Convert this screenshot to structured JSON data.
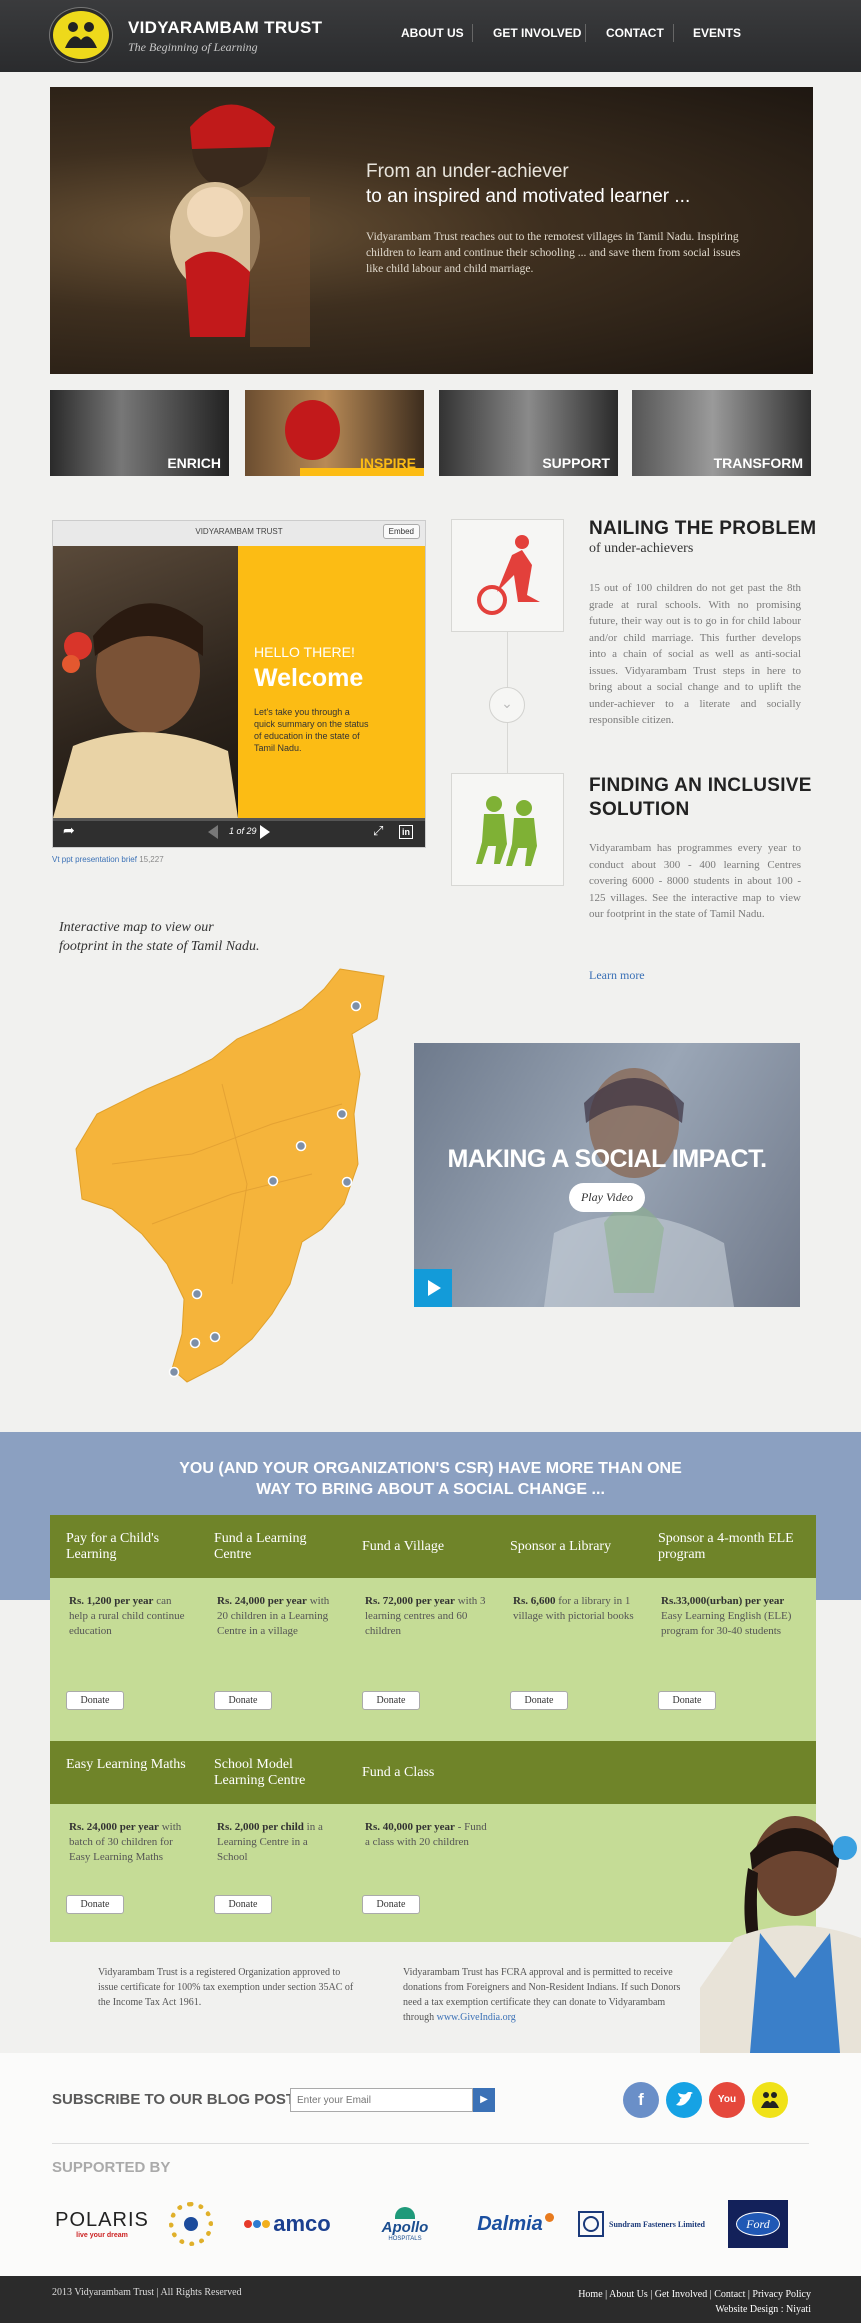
{
  "header": {
    "brand": "VIDYARAMBAM TRUST",
    "tagline": "The Beginning of Learning",
    "nav": [
      "ABOUT US",
      "GET INVOLVED",
      "CONTACT",
      "EVENTS"
    ]
  },
  "hero": {
    "line1": "From an under-achiever",
    "line2": "to an inspired and motivated learner ...",
    "body": "Vidyarambam Trust reaches out to the remotest villages in Tamil Nadu. Inspiring children to learn and continue their schooling ... and save them from social issues like child labour and child marriage."
  },
  "tiles": [
    "ENRICH",
    "INSPIRE",
    "SUPPORT",
    "TRANSFORM"
  ],
  "slideshow": {
    "title": "VIDYARAMBAM TRUST",
    "embed": "Embed",
    "hello": "HELLO THERE!",
    "welcome": "Welcome",
    "summary": "Let's take you through a quick summary on the status of education in the state of Tamil Nadu.",
    "counter": "1 of 29",
    "caption_link": "Vt ppt presentation brief",
    "caption_views": "15,227"
  },
  "problem": {
    "title": "NAILING THE PROBLEM",
    "subtitle": "of under-achievers",
    "body": "15 out of 100 children do not get past the 8th grade at rural schools. With no promising future, their way out is to go in for child labour and/or child marriage. This further develops into a chain of social as well as anti-social issues. Vidyarambam Trust steps in here to bring about a social change and to uplift the under-achiever to a literate and socially responsible citizen."
  },
  "solution": {
    "title_1": "FINDING AN INCLUSIVE",
    "title_2": "SOLUTION",
    "body": "Vidyarambam has programmes every year to conduct about 300 - 400 learning Centres covering 6000 - 8000 students in about 100 - 125 villages. See the interactive map to view our footprint in the state of Tamil Nadu.",
    "learn_more": "Learn more"
  },
  "map": {
    "caption_1": "Interactive map to view our",
    "caption_2": "footprint in the state of Tamil Nadu."
  },
  "video": {
    "title": "MAKING A SOCIAL IMPACT.",
    "button": "Play Video"
  },
  "donate": {
    "heading_1": "YOU (AND YOUR ORGANIZATION'S CSR) HAVE MORE THAN ONE",
    "heading_2": "WAY TO BRING ABOUT A SOCIAL CHANGE ...",
    "button": "Donate",
    "row1": [
      {
        "title": "Pay for a Child's Learning",
        "amount": "Rs. 1,200 per year",
        "desc": " can help a rural child continue education"
      },
      {
        "title": "Fund a Learning Centre",
        "amount": "Rs. 24,000 per year",
        "desc": " with 20 children in a Learning Centre in a village"
      },
      {
        "title": "Fund a Village",
        "amount": "Rs. 72,000 per year",
        "desc": " with 3 learning centres and 60 children"
      },
      {
        "title": "Sponsor a Library",
        "amount": "Rs. 6,600",
        "desc": " for a library in 1 village with pictorial books"
      },
      {
        "title": "Sponsor a 4-month ELE program",
        "amount": "Rs.33,000(urban) per year",
        "desc": " Easy Learning English (ELE) program for 30-40 students"
      }
    ],
    "row2": [
      {
        "title": "Easy Learning Maths",
        "amount": "Rs. 24,000 per year",
        "desc": " with batch of 30 children for Easy Learning Maths"
      },
      {
        "title": "School Model Learning Centre",
        "amount": "Rs. 2,000 per child",
        "desc": " in a Learning Centre in a School"
      },
      {
        "title": "Fund a Class",
        "amount": "Rs. 40,000 per year",
        "desc": " - Fund a class with 20 children"
      }
    ]
  },
  "notices": {
    "left": "Vidyarambam Trust is a registered Organization approved to issue certificate for 100% tax exemption under section 35AC of the Income Tax Act 1961.",
    "right": "Vidyarambam Trust has FCRA approval and is permitted to receive donations from Foreigners and Non-Resident Indians. If such Donors need a tax exemption certificate they can donate to Vidyarambam through ",
    "right_link": "www.GiveIndia.org"
  },
  "subscribe": {
    "heading": "SUBSCRIBE TO OUR BLOG POSTS",
    "placeholder": "Enter your Email",
    "social_icons": [
      "facebook-icon",
      "twitter-icon",
      "youtube-icon",
      "vidyarambam-icon"
    ]
  },
  "supported": {
    "heading": "SUPPORTED BY",
    "polaris": "POLARIS",
    "polaris_tag": "live your dream",
    "amco": "amco",
    "apollo": "Apollo",
    "apollo_tag": "HOSPITALS",
    "dalmia": "Dalmia",
    "sundram": "Sundram Fasteners Limited",
    "ford": "Ford"
  },
  "footer": {
    "copyright": "2013 Vidyarambam Trust | All Rights Reserved",
    "links": [
      "Home",
      "About Us",
      "Get Involved",
      "Contact",
      "Privacy Policy"
    ],
    "design": "Website Design : Niyati"
  },
  "colors": {
    "header_bg": "#2f3032",
    "accent_yellow": "#fcbc14",
    "map_orange": "#f5b43b",
    "donate_green_dark": "#6f8429",
    "donate_green_light": "#c5dc96",
    "band_blue": "#8ba0c1",
    "link_blue": "#3b71b6"
  }
}
